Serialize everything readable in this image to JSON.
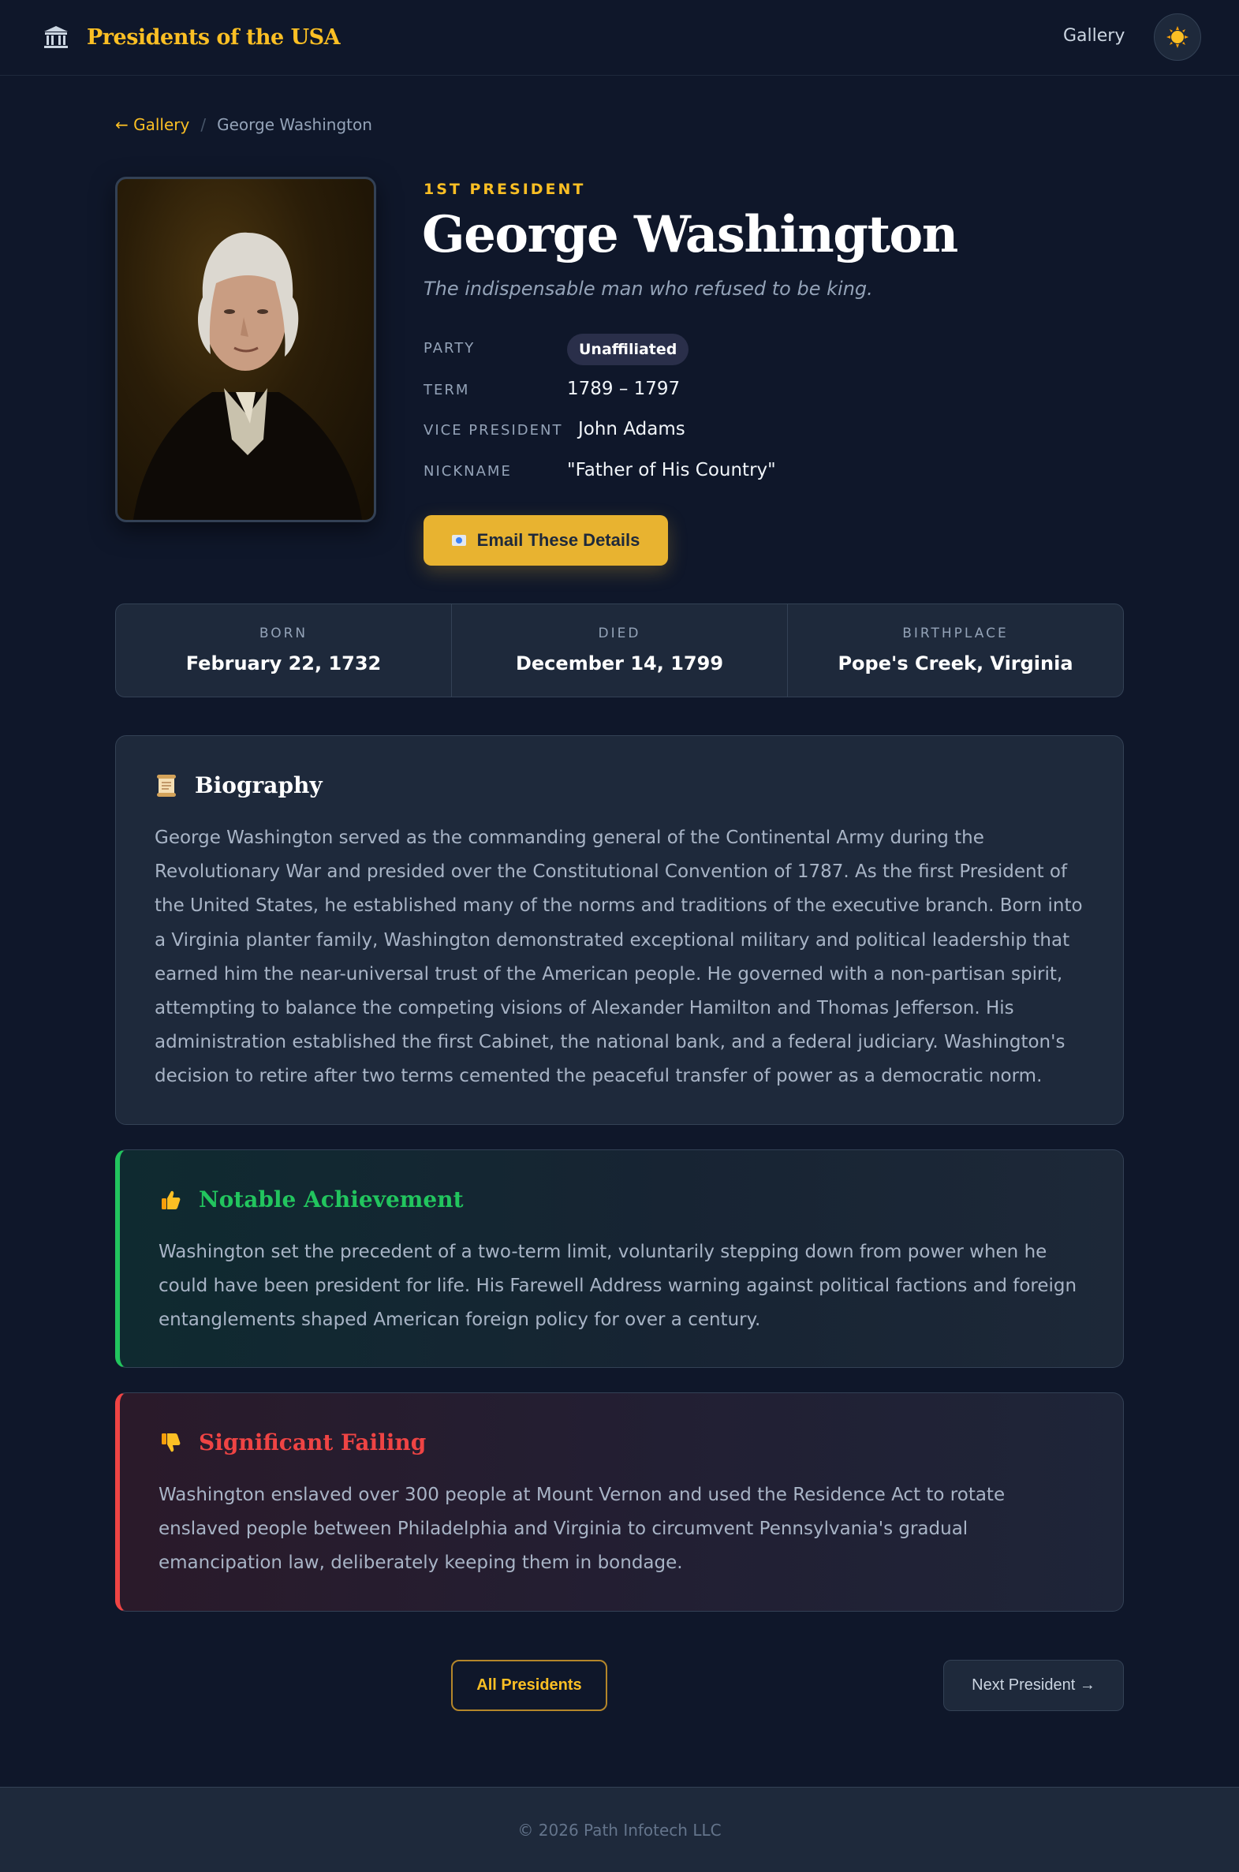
{
  "header": {
    "brand": "Presidents of the USA",
    "nav_gallery": "Gallery"
  },
  "breadcrumb": {
    "back": "← Gallery",
    "separator": "/",
    "current": "George Washington"
  },
  "president": {
    "ordinal": "1ST PRESIDENT",
    "name": "George Washington",
    "tagline": "The indispensable man who refused to be king.",
    "details": {
      "party_label": "PARTY",
      "party": "Unaffiliated",
      "term_label": "TERM",
      "term": "1789 – 1797",
      "vp_label": "VICE PRESIDENT",
      "vp": "John Adams",
      "nickname_label": "NICKNAME",
      "nickname": "\"Father of His Country\""
    },
    "email_button": "Email These Details"
  },
  "stats": {
    "born_label": "BORN",
    "born": "February 22, 1732",
    "died_label": "DIED",
    "died": "December 14, 1799",
    "birthplace_label": "BIRTHPLACE",
    "birthplace": "Pope's Creek, Virginia"
  },
  "biography": {
    "title": "Biography",
    "icon": "scroll-icon",
    "text": "George Washington served as the commanding general of the Continental Army during the Revolutionary War and presided over the Constitutional Convention of 1787. As the first President of the United States, he established many of the norms and traditions of the executive branch. Born into a Virginia planter family, Washington demonstrated exceptional military and political leadership that earned him the near-universal trust of the American people. He governed with a non-partisan spirit, attempting to balance the competing visions of Alexander Hamilton and Thomas Jefferson. His administration established the first Cabinet, the national bank, and a federal judiciary. Washington's decision to retire after two terms cemented the peaceful transfer of power as a democratic norm."
  },
  "achievement": {
    "title": "Notable Achievement",
    "icon": "thumbs-up-icon",
    "color": "#22c55e",
    "text": "Washington set the precedent of a two-term limit, voluntarily stepping down from power when he could have been president for life. His Farewell Address warning against political factions and foreign entanglements shaped American foreign policy for over a century."
  },
  "failing": {
    "title": "Significant Failing",
    "icon": "thumbs-down-icon",
    "color": "#ef4444",
    "text": "Washington enslaved over 300 people at Mount Vernon and used the Residence Act to rotate enslaved people between Philadelphia and Virginia to circumvent Pennsylvania's gradual emancipation law, deliberately keeping them in bondage."
  },
  "navigation": {
    "all_presidents": "All Presidents",
    "next_president": "Next President →"
  },
  "footer": {
    "copyright": "© 2026 Path Infotech LLC"
  },
  "colors": {
    "accent": "#fbbf24",
    "background": "#0f172a",
    "card": "#1e293b"
  }
}
